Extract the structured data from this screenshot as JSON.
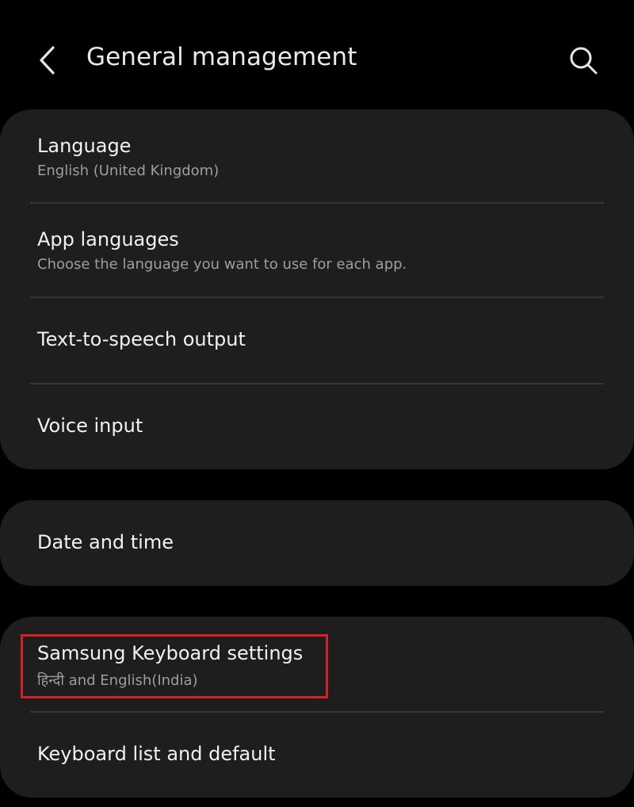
{
  "header": {
    "title": "General management",
    "back_icon": "chevron-left-icon",
    "search_icon": "search-icon"
  },
  "groups": [
    {
      "items": [
        {
          "title": "Language",
          "subtitle": "English (United Kingdom)"
        },
        {
          "title": "App languages",
          "subtitle": "Choose the language you want to use for each app."
        },
        {
          "title": "Text-to-speech output"
        },
        {
          "title": "Voice input"
        }
      ]
    },
    {
      "items": [
        {
          "title": "Date and time"
        }
      ]
    },
    {
      "items": [
        {
          "title": "Samsung Keyboard settings",
          "subtitle": "हिन्दी and English(India)",
          "highlighted": true
        },
        {
          "title": "Keyboard list and default"
        }
      ]
    }
  ],
  "colors": {
    "background": "#000000",
    "card": "#1e1e1e",
    "title_text": "#f1f1f1",
    "subtitle_text": "#9e9ea2",
    "highlight": "#d4212a"
  }
}
